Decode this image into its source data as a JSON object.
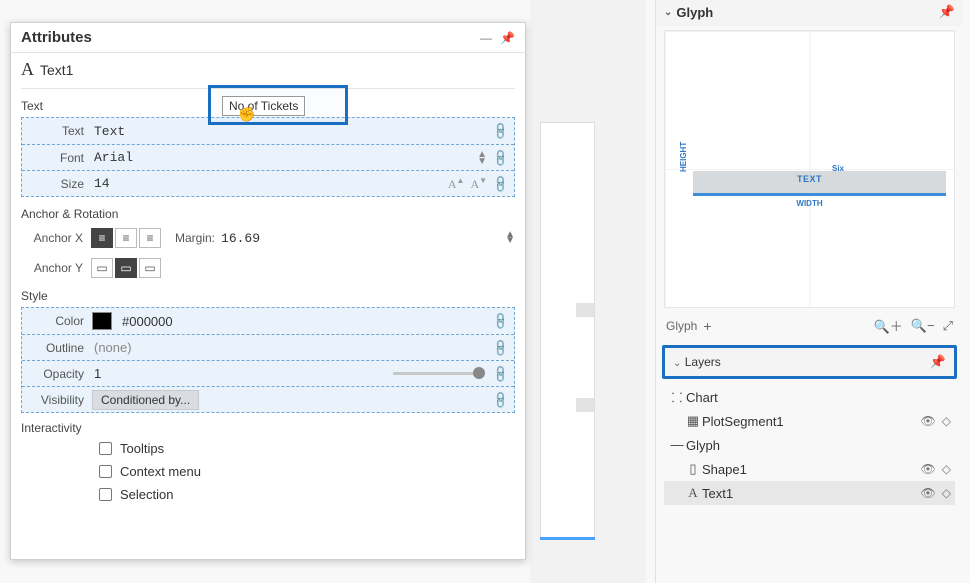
{
  "attributes": {
    "panel_title": "Attributes",
    "object_name": "Text1",
    "sections": {
      "text": "Text",
      "anchor_rotation": "Anchor & Rotation",
      "style": "Style",
      "interactivity": "Interactivity"
    },
    "drop_hint": "No of Tickets",
    "props": {
      "text": {
        "label": "Text",
        "value": "Text"
      },
      "font": {
        "label": "Font",
        "value": "Arial"
      },
      "size": {
        "label": "Size",
        "value": "14"
      }
    },
    "anchor": {
      "x_label": "Anchor X",
      "y_label": "Anchor Y",
      "margin_label": "Margin:",
      "margin_value": "16.69"
    },
    "style": {
      "color": {
        "label": "Color",
        "value": "#000000"
      },
      "outline": {
        "label": "Outline",
        "value": "(none)"
      },
      "opacity": {
        "label": "Opacity",
        "value": "1"
      },
      "visibility": {
        "label": "Visibility",
        "value": "Conditioned by..."
      }
    },
    "interactivity": {
      "tooltips": "Tooltips",
      "context_menu": "Context menu",
      "selection": "Selection"
    }
  },
  "glyph_panel": {
    "title": "Glyph",
    "labels": {
      "text": "TEXT",
      "width": "WIDTH",
      "height": "HEIGHT",
      "six": "Six"
    },
    "toolbar_label": "Glyph"
  },
  "layers_panel": {
    "title": "Layers",
    "items": [
      {
        "name": "Chart",
        "icon": "chart",
        "indent": 0,
        "has_actions": false
      },
      {
        "name": "PlotSegment1",
        "icon": "grid",
        "indent": 1,
        "has_actions": true
      },
      {
        "name": "Glyph",
        "icon": "glyph",
        "indent": 0,
        "has_actions": false
      },
      {
        "name": "Shape1",
        "icon": "rect",
        "indent": 1,
        "has_actions": true
      },
      {
        "name": "Text1",
        "icon": "text",
        "indent": 1,
        "has_actions": true,
        "selected": true
      }
    ]
  }
}
